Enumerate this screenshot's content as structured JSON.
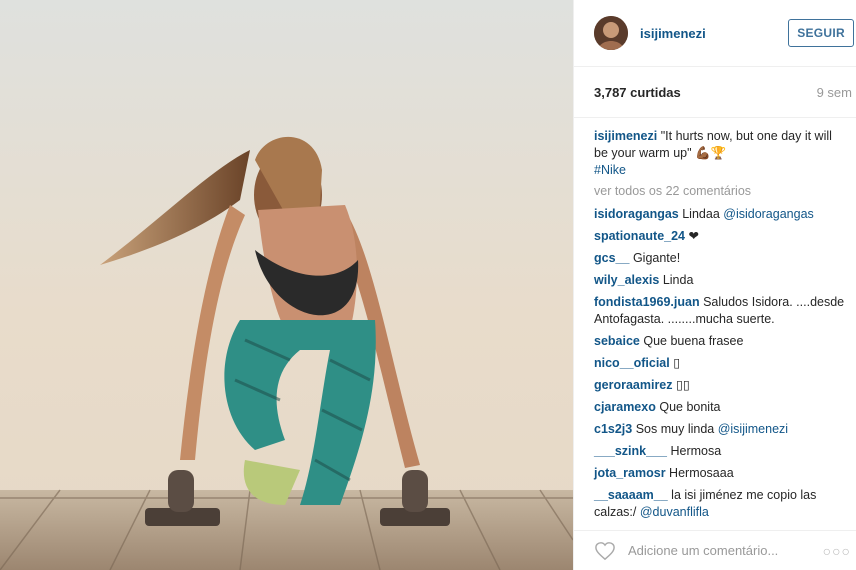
{
  "post": {
    "username": "isijimenezi",
    "follow_label": "SEGUIR",
    "likes": "3,787 curtidas",
    "time_ago": "9 sem",
    "caption": {
      "user": "isijimenezi",
      "text": "\"It hurts now, but one day it will be your warm up\" 💪🏾🏆",
      "hashtag": "#Nike"
    },
    "view_all": "ver todos os 22 comentários",
    "comments": [
      {
        "user": "isidoragangas",
        "text": "Lindaa ",
        "mention": "@isidoragangas"
      },
      {
        "user": "spationaute_24",
        "text": "❤",
        "mention": ""
      },
      {
        "user": "gcs__",
        "text": "Gigante!",
        "mention": ""
      },
      {
        "user": "wily_alexis",
        "text": "Linda",
        "mention": ""
      },
      {
        "user": "fondista1969.juan",
        "text": "Saludos Isidora. ....desde Antofagasta. ........mucha suerte.",
        "mention": ""
      },
      {
        "user": "sebaice",
        "text": "Que buena frasee",
        "mention": ""
      },
      {
        "user": "nico__oficial",
        "text": "▯",
        "mention": ""
      },
      {
        "user": "geroraamirez",
        "text": "▯▯",
        "mention": ""
      },
      {
        "user": "cjaramexo",
        "text": "Que bonita",
        "mention": ""
      },
      {
        "user": "c1s2j3",
        "text": "Sos muy linda ",
        "mention": "@isijimenezi"
      },
      {
        "user": "___szink___",
        "text": "Hermosa",
        "mention": ""
      },
      {
        "user": "jota_ramosr",
        "text": "Hermosaaa",
        "mention": ""
      },
      {
        "user": "__saaaam__",
        "text": "la isi jiménez me copio las calzas:/ ",
        "mention": "@duvanflifla"
      }
    ],
    "add_comment_placeholder": "Adicione um comentário...",
    "more_icon": "more-icon",
    "like_icon": "heart-icon"
  }
}
